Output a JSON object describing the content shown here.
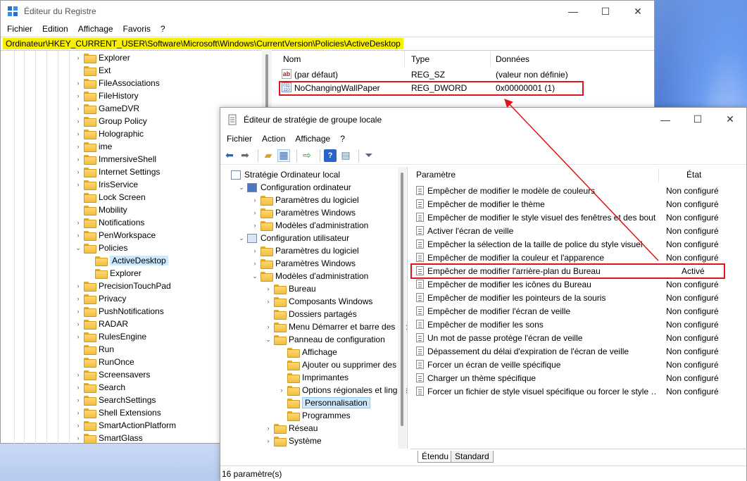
{
  "registry": {
    "title": "Éditeur du Registre",
    "menu": [
      "Fichier",
      "Edition",
      "Affichage",
      "Favoris",
      "?"
    ],
    "address": "Ordinateur\\HKEY_CURRENT_USER\\Software\\Microsoft\\Windows\\CurrentVersion\\Policies\\ActiveDesktop",
    "tree": [
      {
        "label": "Explorer",
        "chev": "›"
      },
      {
        "label": "Ext",
        "chev": ""
      },
      {
        "label": "FileAssociations",
        "chev": "›"
      },
      {
        "label": "FileHistory",
        "chev": "›"
      },
      {
        "label": "GameDVR",
        "chev": "›"
      },
      {
        "label": "Group Policy",
        "chev": "›"
      },
      {
        "label": "Holographic",
        "chev": "›"
      },
      {
        "label": "ime",
        "chev": "›"
      },
      {
        "label": "ImmersiveShell",
        "chev": "›"
      },
      {
        "label": "Internet Settings",
        "chev": "›"
      },
      {
        "label": "IrisService",
        "chev": "›"
      },
      {
        "label": "Lock Screen",
        "chev": ""
      },
      {
        "label": "Mobility",
        "chev": ""
      },
      {
        "label": "Notifications",
        "chev": "›"
      },
      {
        "label": "PenWorkspace",
        "chev": "›"
      },
      {
        "label": "Policies",
        "chev": "⌄"
      },
      {
        "label": "ActiveDesktop",
        "chev": "",
        "child": true,
        "selected": true
      },
      {
        "label": "Explorer",
        "chev": "",
        "child": true
      },
      {
        "label": "PrecisionTouchPad",
        "chev": "›"
      },
      {
        "label": "Privacy",
        "chev": "›"
      },
      {
        "label": "PushNotifications",
        "chev": "›"
      },
      {
        "label": "RADAR",
        "chev": "›"
      },
      {
        "label": "RulesEngine",
        "chev": "›"
      },
      {
        "label": "Run",
        "chev": ""
      },
      {
        "label": "RunOnce",
        "chev": ""
      },
      {
        "label": "Screensavers",
        "chev": "›"
      },
      {
        "label": "Search",
        "chev": "›"
      },
      {
        "label": "SearchSettings",
        "chev": "›"
      },
      {
        "label": "Shell Extensions",
        "chev": "›"
      },
      {
        "label": "SmartActionPlatform",
        "chev": "›"
      },
      {
        "label": "SmartGlass",
        "chev": "›"
      }
    ],
    "columns": {
      "name": "Nom",
      "type": "Type",
      "data": "Données"
    },
    "values": [
      {
        "icon": "string-value-icon",
        "name": "(par défaut)",
        "type": "REG_SZ",
        "data": "(valeur non définie)"
      },
      {
        "icon": "dword-value-icon",
        "name": "NoChangingWallPaper",
        "type": "REG_DWORD",
        "data": "0x00000001 (1)"
      }
    ]
  },
  "gpedit": {
    "title": "Éditeur de stratégie de groupe locale",
    "menu": [
      "Fichier",
      "Action",
      "Affichage",
      "?"
    ],
    "tree": [
      {
        "label": "Stratégie Ordinateur local",
        "indent": 0,
        "chev": "",
        "icon": "policy"
      },
      {
        "label": "Configuration ordinateur",
        "indent": 1,
        "chev": "⌄",
        "icon": "computer"
      },
      {
        "label": "Paramètres du logiciel",
        "indent": 2,
        "chev": "›",
        "icon": "folder"
      },
      {
        "label": "Paramètres Windows",
        "indent": 2,
        "chev": "›",
        "icon": "folder"
      },
      {
        "label": "Modèles d'administration",
        "indent": 2,
        "chev": "›",
        "icon": "folder"
      },
      {
        "label": "Configuration utilisateur",
        "indent": 1,
        "chev": "⌄",
        "icon": "user"
      },
      {
        "label": "Paramètres du logiciel",
        "indent": 2,
        "chev": "›",
        "icon": "folder"
      },
      {
        "label": "Paramètres Windows",
        "indent": 2,
        "chev": "›",
        "icon": "folder"
      },
      {
        "label": "Modèles d'administration",
        "indent": 2,
        "chev": "⌄",
        "icon": "folder"
      },
      {
        "label": "Bureau",
        "indent": 3,
        "chev": "›",
        "icon": "folder"
      },
      {
        "label": "Composants Windows",
        "indent": 3,
        "chev": "›",
        "icon": "folder"
      },
      {
        "label": "Dossiers partagés",
        "indent": 3,
        "chev": "",
        "icon": "folder"
      },
      {
        "label": "Menu Démarrer et barre des tâc",
        "indent": 3,
        "chev": "›",
        "icon": "folder"
      },
      {
        "label": "Panneau de configuration",
        "indent": 3,
        "chev": "⌄",
        "icon": "folder"
      },
      {
        "label": "Affichage",
        "indent": 4,
        "chev": "",
        "icon": "folder"
      },
      {
        "label": "Ajouter ou supprimer des pr",
        "indent": 4,
        "chev": "",
        "icon": "folder"
      },
      {
        "label": "Imprimantes",
        "indent": 4,
        "chev": "",
        "icon": "folder"
      },
      {
        "label": "Options régionales et linguis",
        "indent": 4,
        "chev": "›",
        "icon": "folder"
      },
      {
        "label": "Personnalisation",
        "indent": 4,
        "chev": "",
        "icon": "folder",
        "selected": true
      },
      {
        "label": "Programmes",
        "indent": 4,
        "chev": "",
        "icon": "folder"
      },
      {
        "label": "Réseau",
        "indent": 3,
        "chev": "›",
        "icon": "folder"
      },
      {
        "label": "Système",
        "indent": 3,
        "chev": "›",
        "icon": "folder"
      }
    ],
    "columns": {
      "setting": "Paramètre",
      "state": "État"
    },
    "policies": [
      {
        "name": "Empêcher de modifier le modèle de couleurs",
        "state": "Non configuré"
      },
      {
        "name": "Empêcher de modifier le thème",
        "state": "Non configuré"
      },
      {
        "name": "Empêcher de modifier le style visuel des fenêtres et des bout…",
        "state": "Non configuré"
      },
      {
        "name": "Activer l'écran de veille",
        "state": "Non configuré"
      },
      {
        "name": "Empêcher la sélection de la taille de police du style visuel",
        "state": "Non configuré"
      },
      {
        "name": "Empêcher de modifier la couleur et l'apparence",
        "state": "Non configuré"
      },
      {
        "name": "Empêcher de modifier l'arrière-plan du Bureau",
        "state": "Activé",
        "active": true
      },
      {
        "name": "Empêcher de modifier les icônes du Bureau",
        "state": "Non configuré"
      },
      {
        "name": "Empêcher de modifier les pointeurs de la souris",
        "state": "Non configuré"
      },
      {
        "name": "Empêcher de modifier l'écran de veille",
        "state": "Non configuré"
      },
      {
        "name": "Empêcher de modifier les sons",
        "state": "Non configuré"
      },
      {
        "name": "Un mot de passe protège l'écran de veille",
        "state": "Non configuré"
      },
      {
        "name": "Dépassement du délai d'expiration de l'écran de veille",
        "state": "Non configuré"
      },
      {
        "name": "Forcer un écran de veille spécifique",
        "state": "Non configuré"
      },
      {
        "name": "Charger un thème spécifique",
        "state": "Non configuré"
      },
      {
        "name": "Forcer un fichier de style visuel spécifique ou forcer le style …",
        "state": "Non configuré"
      }
    ],
    "tabs": [
      "Étendu",
      "Standard"
    ],
    "status": "16 paramètre(s)"
  },
  "colors": {
    "highlight": "#e0141b",
    "address_bg": "#f6f000",
    "selection": "#cce8ff"
  }
}
